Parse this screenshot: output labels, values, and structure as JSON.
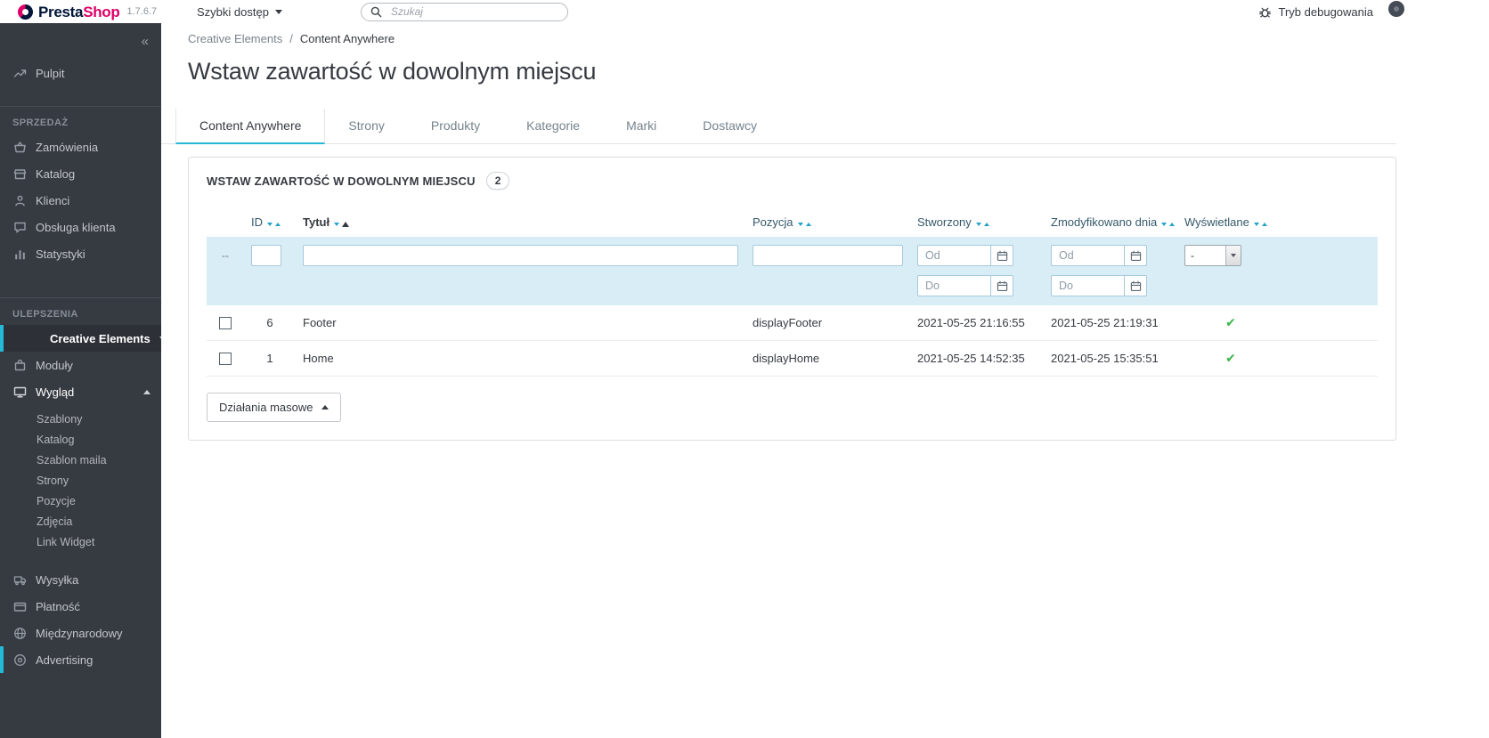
{
  "topbar": {
    "logo": {
      "presta": "Presta",
      "shop": "Shop",
      "version": "1.7.6.7"
    },
    "quick_access_label": "Szybki dostęp",
    "search_placeholder": "Szukaj",
    "debug_label": "Tryb debugowania"
  },
  "sidebar": {
    "collapse": "«",
    "pulpit": "Pulpit",
    "sell_header": "SPRZEDAŻ",
    "sell_items": [
      "Zamówienia",
      "Katalog",
      "Klienci",
      "Obsługa klienta",
      "Statystyki"
    ],
    "improve_header": "ULEPSZENIA",
    "creative_elements": "Creative Elements",
    "moduly": "Moduły",
    "wyglad": "Wygląd",
    "wyglad_children": [
      "Szablony",
      "Katalog",
      "Szablon maila",
      "Strony",
      "Pozycje",
      "Zdjęcia",
      "Link Widget"
    ],
    "bottom_items": [
      "Wysyłka",
      "Płatność",
      "Międzynarodowy",
      "Advertising"
    ]
  },
  "main": {
    "breadcrumb": {
      "parent": "Creative Elements",
      "separator": "/",
      "current": "Content Anywhere"
    },
    "title": "Wstaw zawartość w dowolnym miejscu",
    "tabs": [
      {
        "label": "Content Anywhere",
        "active": true
      },
      {
        "label": "Strony",
        "active": false
      },
      {
        "label": "Produkty",
        "active": false
      },
      {
        "label": "Kategorie",
        "active": false
      },
      {
        "label": "Marki",
        "active": false
      },
      {
        "label": "Dostawcy",
        "active": false
      }
    ],
    "panel": {
      "title": "WSTAW ZAWARTOŚĆ W DOWOLNYM MIEJSCU",
      "count": "2",
      "table": {
        "columns": [
          "ID",
          "Tytuł",
          "Pozycja",
          "Stworzony",
          "Zmodyfikowano dnia",
          "Wyświetlane"
        ],
        "filters": {
          "checkbox_placeholder": "--",
          "date_from_placeholder": "Od",
          "date_to_placeholder": "Do",
          "select_value": "-"
        },
        "rows": [
          {
            "id": "6",
            "title": "Footer",
            "position": "displayFooter",
            "created": "2021-05-25 21:16:55",
            "modified": "2021-05-25 21:19:31",
            "displayed": "✔"
          },
          {
            "id": "1",
            "title": "Home",
            "position": "displayHome",
            "created": "2021-05-25 14:52:35",
            "modified": "2021-05-25 15:35:51",
            "displayed": "✔"
          }
        ]
      },
      "bulk_actions_label": "Działania masowe"
    }
  },
  "colors": {
    "accent_teal": "#25b9d7",
    "sidebar_bg": "#363a41",
    "logo_navy": "#011638",
    "logo_pink": "#df0067",
    "filter_row_bg": "#d9edf7",
    "success_green": "#3bb54a"
  }
}
